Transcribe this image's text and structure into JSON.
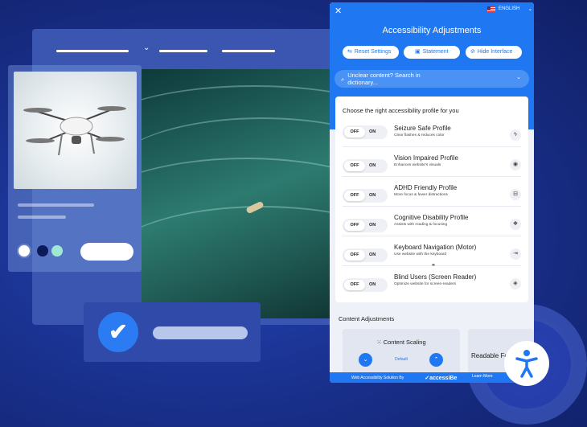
{
  "panel": {
    "close_icon": "close-icon",
    "language": "ENGLISH",
    "title": "Accessibility Adjustments",
    "buttons": {
      "reset": "Reset Settings",
      "statement": "Statement",
      "hide": "Hide Interface"
    },
    "search_placeholder": "Unclear content? Search in dictionary...",
    "profiles_title": "Choose the right accessibility profile for you",
    "toggle_off": "OFF",
    "toggle_on": "ON",
    "profiles": [
      {
        "name": "Seizure Safe Profile",
        "desc": "Clear flashes & reduces color",
        "icon": "bolt-icon"
      },
      {
        "name": "Vision Impaired Profile",
        "desc": "Enhances website's visuals",
        "icon": "eye-icon"
      },
      {
        "name": "ADHD Friendly Profile",
        "desc": "More focus & fewer distractions",
        "icon": "target-icon"
      },
      {
        "name": "Cognitive Disability Profile",
        "desc": "Assists with reading & focusing",
        "icon": "brain-icon"
      },
      {
        "name": "Keyboard Navigation (Motor)",
        "desc": "Use website with the keyboard",
        "icon": "arrow-icon"
      },
      {
        "name": "Blind Users (Screen Reader)",
        "desc": "Optimize website for screen-readers",
        "icon": "audio-icon"
      }
    ],
    "content_adjustments": "Content Adjustments",
    "content_scaling": "Content Scaling",
    "scaling_value": "Default",
    "readable_font": "Readable Font",
    "footer_text": "Web Accessibility Solution By",
    "footer_brand": "accessiBe",
    "learn_more": "Learn More"
  },
  "colors": {
    "accent": "#1f78f1",
    "background": "#1a3290"
  }
}
